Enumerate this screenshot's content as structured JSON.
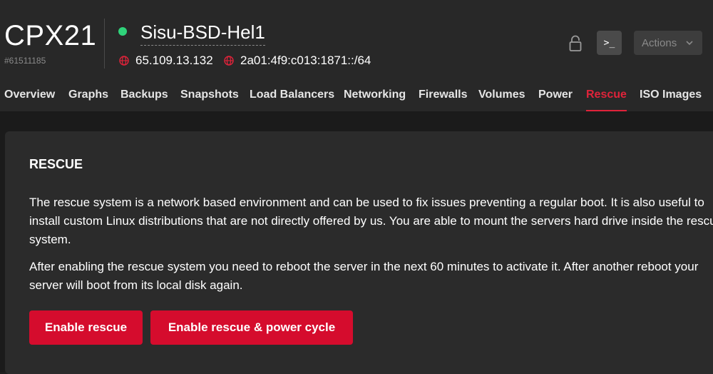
{
  "server": {
    "type": "CPX21",
    "id": "#61511185",
    "name": "Sisu-BSD-Hel1",
    "status_color": "#2fd37a",
    "ipv4": "65.109.13.132",
    "ipv6": "2a01:4f9:c013:1871::/64"
  },
  "toolbar": {
    "lock_icon": "lock-icon",
    "console_label": ">_",
    "actions_label": "Actions"
  },
  "tabs": [
    {
      "label": "Overview"
    },
    {
      "label": "Graphs"
    },
    {
      "label": "Backups"
    },
    {
      "label": "Snapshots"
    },
    {
      "label": "Load Balancers"
    },
    {
      "label": "Networking"
    },
    {
      "label": "Firewalls"
    },
    {
      "label": "Volumes"
    },
    {
      "label": "Power"
    },
    {
      "label": "Rescue",
      "active": true
    },
    {
      "label": "ISO Images"
    }
  ],
  "rescue": {
    "title": "RESCUE",
    "description_1": "The rescue system is a network based environment and can be used to fix issues preventing a regular boot. It is also useful to install custom Linux distributions that are not directly offered by us. You are able to mount the servers hard drive inside the rescue system.",
    "description_2": "After enabling the rescue system you need to reboot the server in the next 60 minutes to activate it. After another reboot your server will boot from its local disk again.",
    "enable_label": "Enable rescue",
    "enable_power_cycle_label": "Enable rescue & power cycle"
  },
  "colors": {
    "accent": "#d50c2d",
    "active_tab": "#e0233a",
    "globe_icon": "#e0233a"
  }
}
